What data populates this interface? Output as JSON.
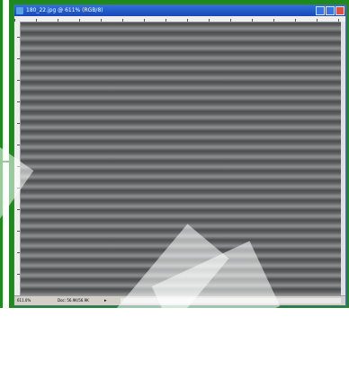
{
  "window": {
    "title": "180_22.jpg @ 611% (RGB/8)"
  },
  "statusbar": {
    "zoom": "611.0%",
    "doc_info": "Doc: 56.9K/56.9K",
    "arrow": "▸"
  },
  "colors": {
    "frame_green": "#1e8a1e",
    "titlebar_blue": "#1747b8",
    "canvas_gray": "#6e7071"
  }
}
